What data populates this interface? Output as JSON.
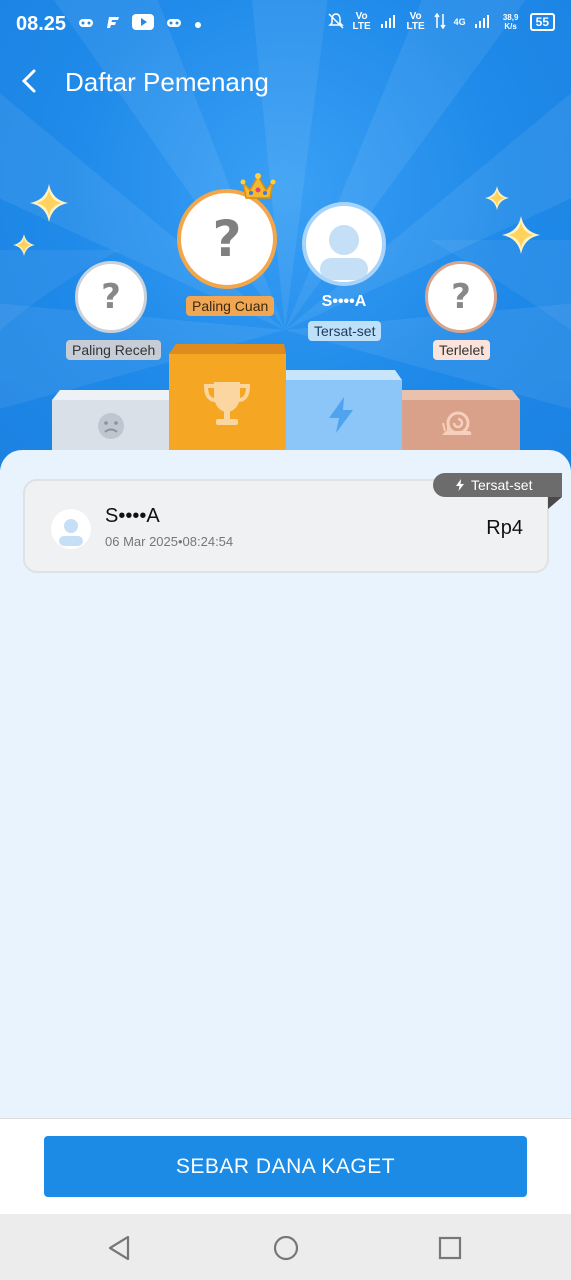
{
  "status_bar": {
    "time": "08.25",
    "net1": "Vo LTE",
    "net2": "Vo LTE",
    "net_type": "4G",
    "speed": "38,9 K/s",
    "battery": "55"
  },
  "header": {
    "title": "Daftar Pemenang"
  },
  "podium": {
    "first": {
      "label": "Paling Cuan",
      "avatar": "?"
    },
    "second": {
      "label": "Paling Receh",
      "avatar": "?"
    },
    "third": {
      "name": "S••••A",
      "label": "Tersat-set"
    },
    "fourth": {
      "label": "Terlelet",
      "avatar": "?"
    }
  },
  "winners": [
    {
      "name": "S••••A",
      "date": "06 Mar 2025•08:24:54",
      "amount": "Rp4",
      "badge": "Tersat-set"
    }
  ],
  "cta": {
    "label": "SEBAR DANA KAGET"
  },
  "colors": {
    "primary": "#1b8be6",
    "gold": "#f5a623",
    "copper": "#d9a08a"
  }
}
